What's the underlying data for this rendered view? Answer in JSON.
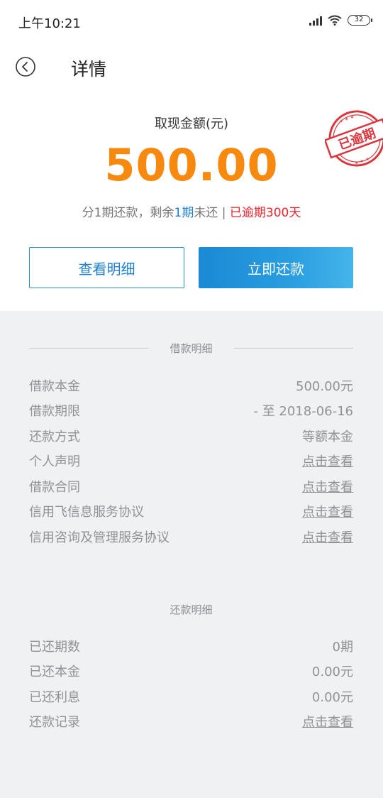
{
  "status": {
    "time": "上午10:21",
    "battery": "32"
  },
  "header": {
    "title": "详情"
  },
  "summary": {
    "amount_label": "取现金额(元)",
    "amount": "500.00",
    "stamp_text": "已逾期",
    "installment_prefix": "分1期还款，剩余",
    "installment_remaining": "1期",
    "installment_mid": "未还 | ",
    "overdue_text": "已逾期300天"
  },
  "actions": {
    "detail_label": "查看明细",
    "repay_label": "立即还款"
  },
  "loan": {
    "title": "借款明细",
    "rows": [
      {
        "k": "借款本金",
        "v": "500.00元"
      },
      {
        "k": "借款期限",
        "v": "- 至 2018-06-16"
      },
      {
        "k": "还款方式",
        "v": "等额本金"
      },
      {
        "k": "个人声明",
        "v": "点击查看"
      },
      {
        "k": "借款合同",
        "v": "点击查看"
      },
      {
        "k": "信用飞信息服务协议",
        "v": "点击查看"
      },
      {
        "k": "信用咨询及管理服务协议",
        "v": "点击查看"
      }
    ]
  },
  "repay": {
    "title": "还款明细",
    "rows": [
      {
        "k": "已还期数",
        "v": "0期"
      },
      {
        "k": "已还本金",
        "v": "0.00元"
      },
      {
        "k": "已还利息",
        "v": "0.00元"
      },
      {
        "k": "还款记录",
        "v": "点击查看"
      }
    ]
  },
  "colors": {
    "accent": "#f7890f",
    "blue": "#1e7fd6",
    "red": "#e8262e",
    "stamp": "#d9363e"
  }
}
